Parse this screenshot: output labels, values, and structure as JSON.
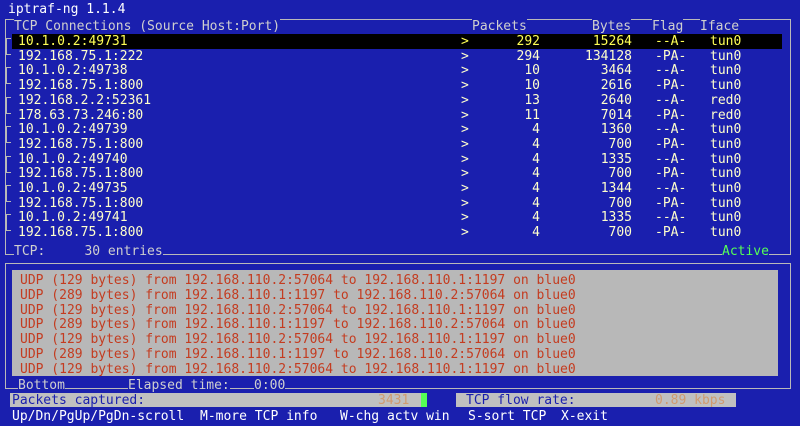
{
  "title": "iptraf-ng 1.1.4",
  "tcp_window": {
    "header": {
      "connections": "TCP Connections (Source Host:Port)",
      "packets": "Packets",
      "bytes": "Bytes",
      "flag": "Flag",
      "iface": "Iface"
    },
    "rows": [
      {
        "host": "10.1.0.2:49731",
        "arrow": ">",
        "packets": "292",
        "bytes": "15264",
        "flag": "--A-",
        "iface": "tun0"
      },
      {
        "host": "192.168.75.1:222",
        "arrow": ">",
        "packets": "294",
        "bytes": "134128",
        "flag": "-PA-",
        "iface": "tun0"
      },
      {
        "host": "10.1.0.2:49738",
        "arrow": ">",
        "packets": "10",
        "bytes": "3464",
        "flag": "--A-",
        "iface": "tun0"
      },
      {
        "host": "192.168.75.1:800",
        "arrow": ">",
        "packets": "10",
        "bytes": "2616",
        "flag": "-PA-",
        "iface": "tun0"
      },
      {
        "host": "192.168.2.2:52361",
        "arrow": ">",
        "packets": "13",
        "bytes": "2640",
        "flag": "--A-",
        "iface": "red0"
      },
      {
        "host": "178.63.73.246:80",
        "arrow": ">",
        "packets": "11",
        "bytes": "7014",
        "flag": "-PA-",
        "iface": "red0"
      },
      {
        "host": "10.1.0.2:49739",
        "arrow": ">",
        "packets": "4",
        "bytes": "1360",
        "flag": "--A-",
        "iface": "tun0"
      },
      {
        "host": "192.168.75.1:800",
        "arrow": ">",
        "packets": "4",
        "bytes": "700",
        "flag": "-PA-",
        "iface": "tun0"
      },
      {
        "host": "10.1.0.2:49740",
        "arrow": ">",
        "packets": "4",
        "bytes": "1335",
        "flag": "--A-",
        "iface": "tun0"
      },
      {
        "host": "192.168.75.1:800",
        "arrow": ">",
        "packets": "4",
        "bytes": "700",
        "flag": "-PA-",
        "iface": "tun0"
      },
      {
        "host": "10.1.0.2:49735",
        "arrow": ">",
        "packets": "4",
        "bytes": "1344",
        "flag": "--A-",
        "iface": "tun0"
      },
      {
        "host": "192.168.75.1:800",
        "arrow": ">",
        "packets": "4",
        "bytes": "700",
        "flag": "-PA-",
        "iface": "tun0"
      },
      {
        "host": "10.1.0.2:49741",
        "arrow": ">",
        "packets": "4",
        "bytes": "1335",
        "flag": "--A-",
        "iface": "tun0"
      },
      {
        "host": "192.168.75.1:800",
        "arrow": ">",
        "packets": "4",
        "bytes": "700",
        "flag": "-PA-",
        "iface": "tun0"
      }
    ],
    "status": "TCP:     30 entries",
    "active": "Active"
  },
  "other_window": {
    "lines": [
      "UDP (129 bytes) from 192.168.110.2:57064 to 192.168.110.1:1197 on blue0",
      "UDP (289 bytes) from 192.168.110.1:1197 to 192.168.110.2:57064 on blue0",
      "UDP (129 bytes) from 192.168.110.2:57064 to 192.168.110.1:1197 on blue0",
      "UDP (289 bytes) from 192.168.110.1:1197 to 192.168.110.2:57064 on blue0",
      "UDP (129 bytes) from 192.168.110.2:57064 to 192.168.110.1:1197 on blue0",
      "UDP (289 bytes) from 192.168.110.1:1197 to 192.168.110.2:57064 on blue0",
      "UDP (129 bytes) from 192.168.110.2:57064 to 192.168.110.1:1197 on blue0"
    ],
    "bottom_label": "Bottom",
    "elapsed_label": "Elapsed time:",
    "elapsed_value": "0:00"
  },
  "counters": {
    "packets_label": "Packets captured:",
    "packets_value": "3431",
    "flow_label": "TCP flow rate:",
    "flow_value": "0.89 kbps"
  },
  "help": [
    {
      "key": "Up/Dn/PgUp/PgDn",
      "text": "-scroll"
    },
    {
      "key": "M",
      "text": "-more TCP info"
    },
    {
      "key": "W",
      "text": "-chg actv win"
    },
    {
      "key": "S",
      "text": "-sort TCP"
    },
    {
      "key": "X",
      "text": "-exit"
    }
  ],
  "colors": {
    "background": "#1a1fae",
    "row_text": "#ffffcc",
    "selected_bg": "#000000",
    "udp_text": "#c43c20",
    "udp_bg": "#b8b8b8",
    "active": "#55ff55"
  }
}
